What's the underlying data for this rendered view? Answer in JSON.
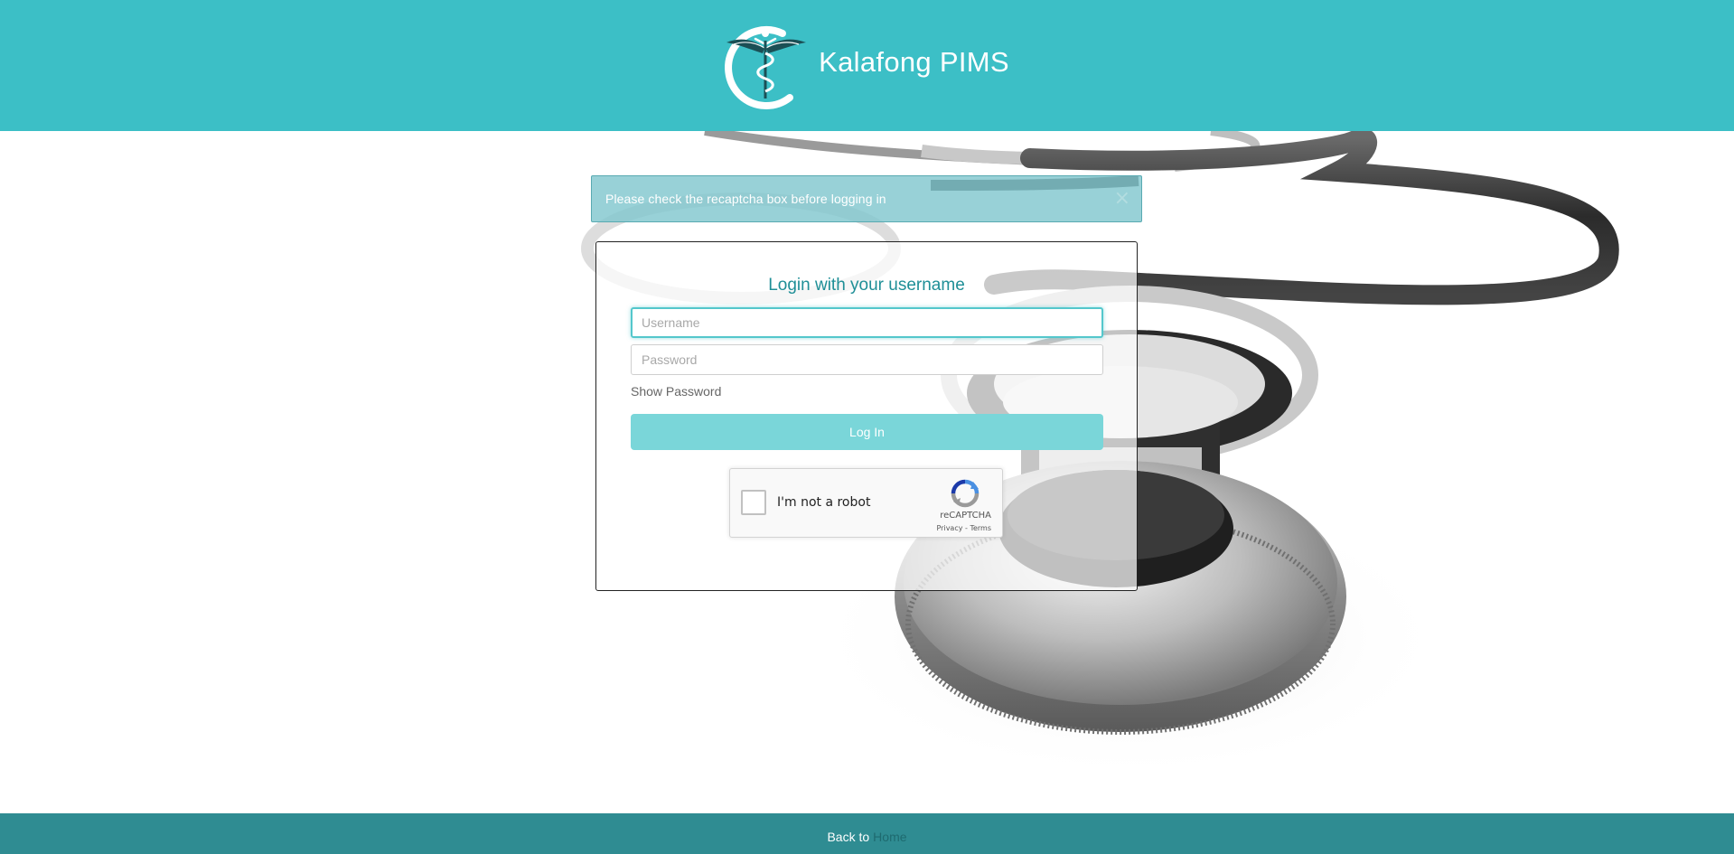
{
  "header": {
    "brand_name": "Kalafong PIMS",
    "background_color": "#3cbfc6",
    "logo_icon": "caduceus-logo-icon"
  },
  "alert": {
    "message": "Please check the recaptcha box before logging in",
    "close_label": "×"
  },
  "login": {
    "title": "Login with your username",
    "username_placeholder": "Username",
    "username_value": "",
    "password_placeholder": "Password",
    "password_value": "",
    "show_password_label": "Show Password",
    "login_button_label": "Log In"
  },
  "recaptcha": {
    "checkbox_label": "I'm not a robot",
    "brand": "reCAPTCHA",
    "links": "Privacy - Terms"
  },
  "footer": {
    "text": "Back to",
    "link_label": "Home",
    "background_color": "#2f8c92"
  },
  "colors": {
    "accent": "#3cbfc6",
    "title": "#1f8f97",
    "button": "#7ad6d9"
  }
}
